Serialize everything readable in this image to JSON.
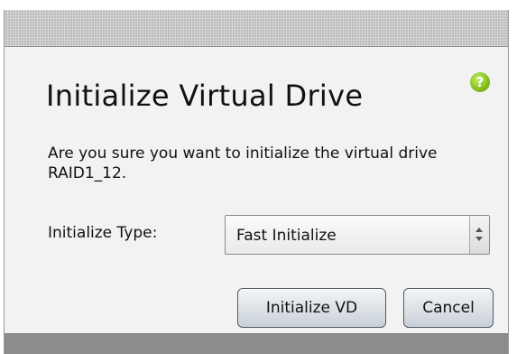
{
  "dialog": {
    "title": "Initialize Virtual Drive",
    "help_icon": "help-icon",
    "help_glyph": "?",
    "message": "Are you sure you want to initialize the virtual drive RAID1_12.",
    "initialize_type_label": "Initialize Type:",
    "initialize_type_value": "Fast Initialize",
    "buttons": {
      "initialize_label": "Initialize VD",
      "cancel_label": "Cancel"
    }
  },
  "colors": {
    "help_icon": "#86c21f",
    "title_bar": "#b9b9b9",
    "dialog_bg": "#f2f2f2",
    "button_border": "#4f5a66"
  }
}
